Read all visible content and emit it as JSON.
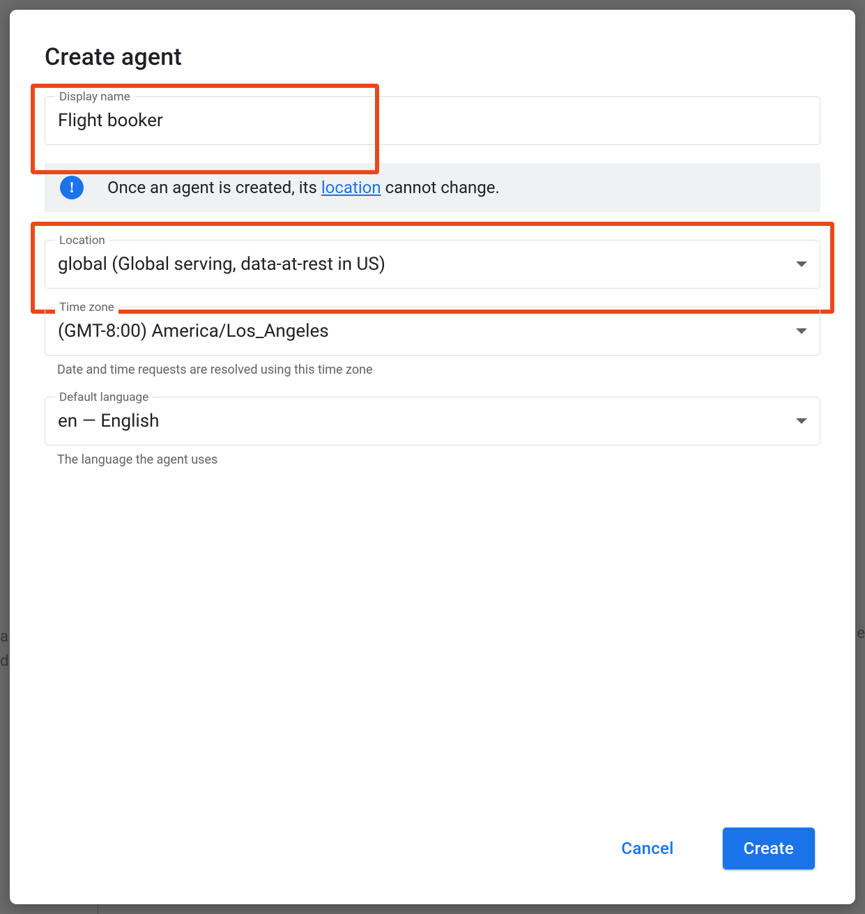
{
  "dialog": {
    "title": "Create agent",
    "display_name": {
      "label": "Display name",
      "value": "Flight booker"
    },
    "info": {
      "text_before": "Once an agent is created, its ",
      "link_text": "location",
      "text_after": " cannot change."
    },
    "location": {
      "label": "Location",
      "value": "global (Global serving, data-at-rest in US)"
    },
    "time_zone": {
      "label": "Time zone",
      "value": "(GMT-8:00) America/Los_Angeles",
      "helper": "Date and time requests are resolved using this time zone"
    },
    "default_language": {
      "label": "Default language",
      "value": "en — English",
      "helper": "The language the agent uses"
    },
    "actions": {
      "cancel": "Cancel",
      "create": "Create"
    }
  }
}
